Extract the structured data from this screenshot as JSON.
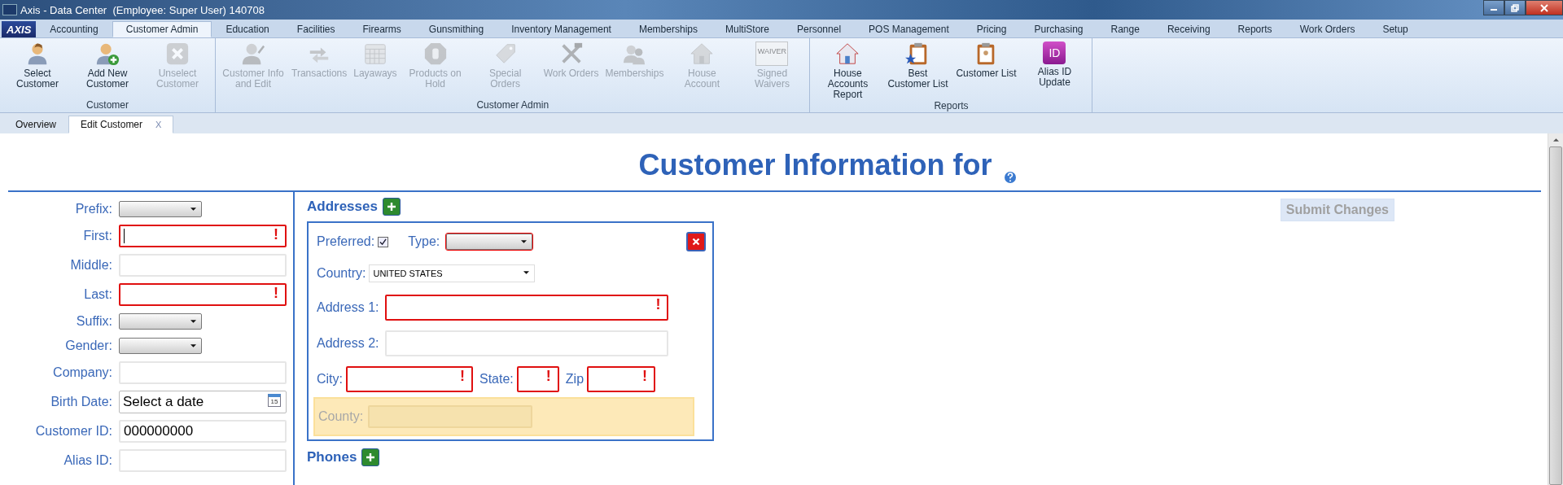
{
  "window": {
    "title": "Axis - Data Center  (Employee: Super User) 140708"
  },
  "logo": "AXIS",
  "menu_tabs": [
    {
      "label": "Accounting",
      "selected": false
    },
    {
      "label": "Customer Admin",
      "selected": true
    },
    {
      "label": "Education",
      "selected": false
    },
    {
      "label": "Facilities",
      "selected": false
    },
    {
      "label": "Firearms",
      "selected": false
    },
    {
      "label": "Gunsmithing",
      "selected": false
    },
    {
      "label": "Inventory Management",
      "selected": false
    },
    {
      "label": "Memberships",
      "selected": false
    },
    {
      "label": "MultiStore",
      "selected": false
    },
    {
      "label": "Personnel",
      "selected": false
    },
    {
      "label": "POS Management",
      "selected": false
    },
    {
      "label": "Pricing",
      "selected": false
    },
    {
      "label": "Purchasing",
      "selected": false
    },
    {
      "label": "Range",
      "selected": false
    },
    {
      "label": "Receiving",
      "selected": false
    },
    {
      "label": "Reports",
      "selected": false
    },
    {
      "label": "Work Orders",
      "selected": false
    },
    {
      "label": "Setup",
      "selected": false
    }
  ],
  "ribbon_groups": [
    {
      "label": "Customer",
      "buttons": [
        {
          "label": "Select Customer",
          "disabled": false
        },
        {
          "label": "Add New Customer",
          "disabled": false
        },
        {
          "label": "Unselect Customer",
          "disabled": true
        }
      ]
    },
    {
      "label": "Customer Admin",
      "buttons": [
        {
          "label": "Customer Info and Edit",
          "disabled": true
        },
        {
          "label": "Transactions",
          "disabled": true
        },
        {
          "label": "Layaways",
          "disabled": true
        },
        {
          "label": "Products on Hold",
          "disabled": true
        },
        {
          "label": "Special Orders",
          "disabled": true
        },
        {
          "label": "Work Orders",
          "disabled": true
        },
        {
          "label": "Memberships",
          "disabled": true
        },
        {
          "label": "House Account",
          "disabled": true
        },
        {
          "label": "Signed Waivers",
          "disabled": true,
          "icon_text": "WAIVER"
        }
      ]
    },
    {
      "label": "Reports",
      "buttons": [
        {
          "label": "House Accounts Report",
          "disabled": false
        },
        {
          "label": "Best Customer List",
          "disabled": false
        },
        {
          "label": "Customer List",
          "disabled": false
        },
        {
          "label": "Alias ID Update",
          "disabled": false,
          "icon_text": "ID"
        }
      ]
    }
  ],
  "doc_tabs": [
    {
      "label": "Overview",
      "selected": false
    },
    {
      "label": "Edit Customer",
      "selected": true,
      "close": "X"
    }
  ],
  "page_title": "Customer Information for",
  "submit": {
    "label": "Submit Changes",
    "disabled": true
  },
  "customer_fields": [
    {
      "label": "Prefix:",
      "kind": "select",
      "invalid": false
    },
    {
      "label": "First:",
      "kind": "text",
      "invalid": true,
      "error_mark": "!",
      "focused": true
    },
    {
      "label": "Middle:",
      "kind": "text",
      "invalid": false
    },
    {
      "label": "Last:",
      "kind": "text",
      "invalid": true,
      "error_mark": "!"
    },
    {
      "label": "Suffix:",
      "kind": "select",
      "invalid": false
    },
    {
      "label": "Gender:",
      "kind": "select",
      "invalid": false
    },
    {
      "label": "Company:",
      "kind": "text",
      "invalid": false
    },
    {
      "label": "Birth Date:",
      "kind": "date",
      "invalid": false,
      "placeholder": "Select a date",
      "icon_text": "15"
    },
    {
      "label": "Customer ID:",
      "kind": "text",
      "invalid": false,
      "value": "000000000"
    },
    {
      "label": "Alias ID:",
      "kind": "text",
      "invalid": false
    }
  ],
  "addresses": {
    "heading": "Addresses",
    "address": {
      "preferred_label": "Preferred:",
      "preferred": true,
      "type_label": "Type:",
      "type_invalid": true,
      "country_label": "Country:",
      "country": "UNITED STATES",
      "address1": {
        "label": "Address 1:",
        "invalid": true,
        "error_mark": "!"
      },
      "address2": {
        "label": "Address 2:",
        "invalid": false
      },
      "city": {
        "label": "City:",
        "invalid": true,
        "error_mark": "!"
      },
      "state": {
        "label": "State:",
        "invalid": true,
        "error_mark": "!"
      },
      "zip": {
        "label": "Zip",
        "invalid": true,
        "error_mark": "!"
      },
      "county": {
        "label": "County:",
        "disabled": true
      }
    }
  },
  "phones": {
    "heading": "Phones"
  }
}
